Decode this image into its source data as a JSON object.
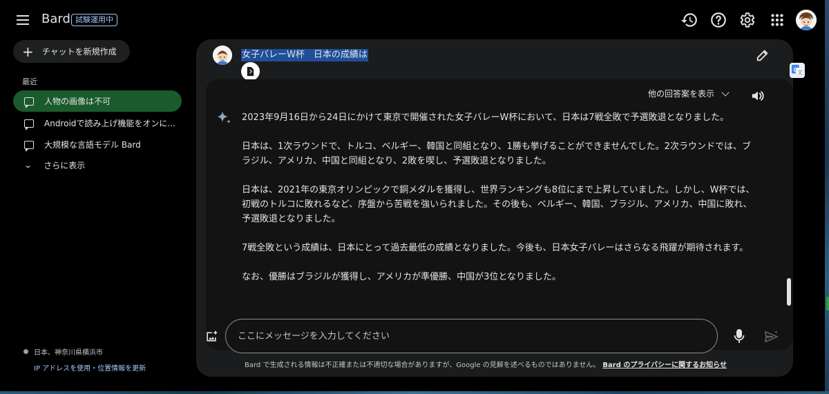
{
  "topbar": {
    "brand": "Bard",
    "badge": "試験運用中",
    "icons": [
      "history-icon",
      "help-icon",
      "settings-icon",
      "apps-grid-icon",
      "account-avatar"
    ]
  },
  "sidebar": {
    "new_chat_label": "チャットを新規作成",
    "recent_title": "最近",
    "items": [
      {
        "label": "人物の画像は不可",
        "active": true
      },
      {
        "label": "Androidで読み上げ機能をオンに...",
        "active": false
      },
      {
        "label": "大規模な言語モデル Bard",
        "active": false
      }
    ],
    "show_more": "さらに表示",
    "location": "日本、神奈川県横浜市",
    "location_link": "IP アドレスを使用・位置情報を更新"
  },
  "conversation": {
    "query": "女子バレーW杯　日本の成績は",
    "drafts_label": "他の回答案を表示",
    "response_paragraphs": [
      "2023年9月16日から24日にかけて東京で開催された女子バレーW杯において、日本は7戦全敗で予選敗退となりました。",
      "日本は、1次ラウンドで、トルコ、ベルギー、韓国と同組となり、1勝も挙げることができませんでした。2次ラウンドでは、ブラジル、アメリカ、中国と同組となり、2敗を喫し、予選敗退となりました。",
      "日本は、2021年の東京オリンピックで銅メダルを獲得し、世界ランキングも8位にまで上昇していました。しかし、W杯では、初戦のトルコに敗れるなど、序盤から苦戦を強いられました。その後も、ベルギー、韓国、ブラジル、アメリカ、中国に敗れ、予選敗退となりました。",
      "7戦全敗という成績は、日本にとって過去最低の成績となりました。今後も、日本女子バレーはさらなる飛躍が期待されます。",
      "なお、優勝はブラジルが獲得し、アメリカが準優勝、中国が3位となりました。"
    ]
  },
  "composer": {
    "placeholder": "ここにメッセージを入力してください",
    "disclaimer": "Bard で生成される情報は不正確または不適切な場合がありますが、Google の見解を述べるものではありません。",
    "privacy_link": "Bard のプライバシーに関するお知らせ"
  },
  "colors": {
    "background": "#000000",
    "panel": "#1b1c1d",
    "active_item": "#1a5a2c",
    "highlight": "#1f4f9a",
    "link": "#a8c7fa"
  }
}
